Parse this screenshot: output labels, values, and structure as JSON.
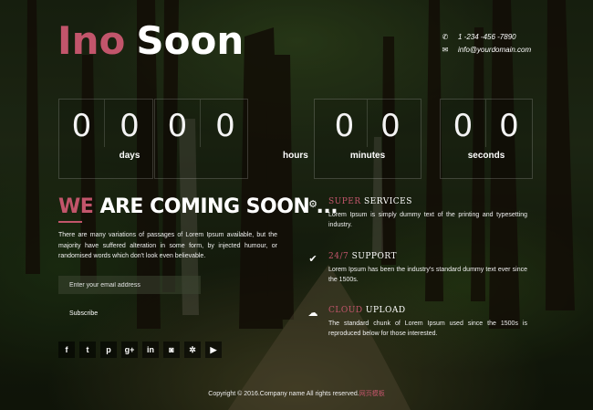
{
  "brand": {
    "part1": "Ino",
    "part2": "Soon"
  },
  "contact": {
    "phone": "1 -234 -456 -7890",
    "email": "info@yourdomain.com",
    "phone_icon": "phone-icon",
    "email_icon": "envelope-icon"
  },
  "countdown": [
    {
      "digits": [
        "0",
        "0"
      ],
      "label": "days"
    },
    {
      "digits": [
        "0",
        "0"
      ],
      "label": "hours"
    },
    {
      "digits": [
        "0",
        "0"
      ],
      "label": "minutes"
    },
    {
      "digits": [
        "0",
        "0"
      ],
      "label": "seconds"
    }
  ],
  "heading": {
    "accent": "WE",
    "rest": "ARE COMING SOON ..."
  },
  "intro": "There are many variations of passages of Lorem Ipsum available, but the majority have suffered alteration in some form, by injected humour, or randomised words which don't look even believable.",
  "subscribe": {
    "placeholder": "Enter your email address",
    "button": "Subscribe"
  },
  "social": [
    {
      "icon": "facebook-icon",
      "glyph": "f"
    },
    {
      "icon": "twitter-icon",
      "glyph": "t"
    },
    {
      "icon": "pinterest-icon",
      "glyph": "p"
    },
    {
      "icon": "google-plus-icon",
      "glyph": "g+"
    },
    {
      "icon": "linkedin-icon",
      "glyph": "in"
    },
    {
      "icon": "instagram-icon",
      "glyph": "◙"
    },
    {
      "icon": "yelp-icon",
      "glyph": "✲"
    },
    {
      "icon": "youtube-icon",
      "glyph": "▶"
    }
  ],
  "features": [
    {
      "icon": "gears-icon",
      "glyph": "⚙",
      "accent": "SUPER",
      "rest": " SERVICES",
      "desc": "Lorem Ipsum is simply dummy text of the printing and typesetting industry."
    },
    {
      "icon": "checkmark-icon",
      "glyph": "✔",
      "accent": "24/7",
      "rest": " SUPPORT",
      "desc": "Lorem Ipsum has been the industry's standard dummy text ever since the 1500s."
    },
    {
      "icon": "cloud-upload-icon",
      "glyph": "☁",
      "accent": "CLOUD",
      "rest": " UPLOAD",
      "desc": "The standard chunk of Lorem Ipsum used since the 1500s is reproduced below for those interested."
    }
  ],
  "footer": {
    "text": "Copyright © 2016.Company name All rights reserved.",
    "link": "网页模板"
  },
  "colors": {
    "accent": "#c2556b"
  }
}
